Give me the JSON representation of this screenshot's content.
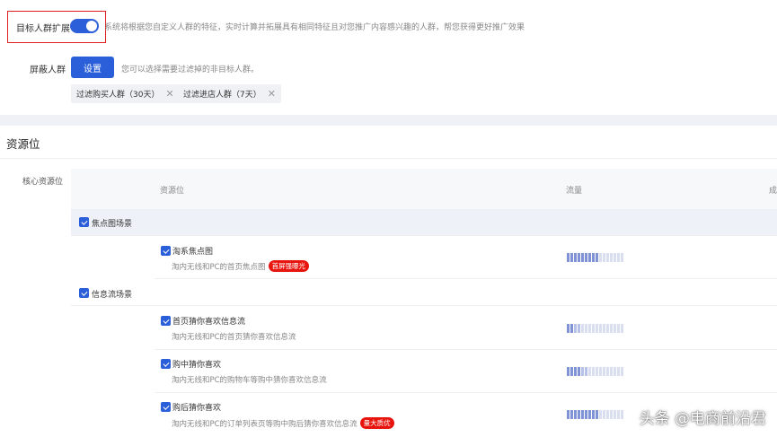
{
  "audience_expand": {
    "label": "目标人群扩展",
    "enabled": true,
    "description": "系统将根据您自定义人群的特征，实时计算并拓展具有相同特征且对您推广内容感兴趣的人群，帮您获得更好推广效果"
  },
  "exclude_audience": {
    "label": "屏蔽人群",
    "button": "设置",
    "hint": "您可以选择需要过滤掉的非目标人群。",
    "tags": [
      {
        "label": "过滤购买人群（30天）",
        "close_icon": "close-icon"
      },
      {
        "label": "过滤进店人群（7天）",
        "close_icon": "close-icon"
      }
    ]
  },
  "resources": {
    "section_title": "资源位",
    "core_label": "核心资源位",
    "columns": [
      "资源位",
      "流量",
      "成"
    ],
    "groups": [
      {
        "label": "焦点图场景",
        "checked": true,
        "items": [
          {
            "title": "淘系焦点图",
            "desc": "淘内无线和PC的首页焦点图",
            "badge": "首屏强曝光",
            "checked": true,
            "traffic_level": 0.55
          }
        ]
      },
      {
        "label": "信息流场景",
        "checked": true,
        "items": [
          {
            "title": "首页猜你喜欢信息流",
            "desc": "淘内无线和PC的首页猜你喜欢信息流",
            "badge": "",
            "checked": true,
            "traffic_level": 0.25
          },
          {
            "title": "购中猜你喜欢",
            "desc": "淘内无线和PC的购物车等购中猜你喜欢信息流",
            "badge": "",
            "checked": true,
            "traffic_level": 0.4
          },
          {
            "title": "购后猜你喜欢",
            "desc": "淘内无线和PC的订单列表页等购中购后猜你喜欢信息流",
            "badge": "量大质优",
            "checked": true,
            "traffic_level": 0.55
          }
        ]
      }
    ]
  },
  "watermark": "头条 @电商前沿君",
  "colors": {
    "accent": "#2b5fd9",
    "badge": "#e8150e",
    "highlight": "#e02020"
  }
}
